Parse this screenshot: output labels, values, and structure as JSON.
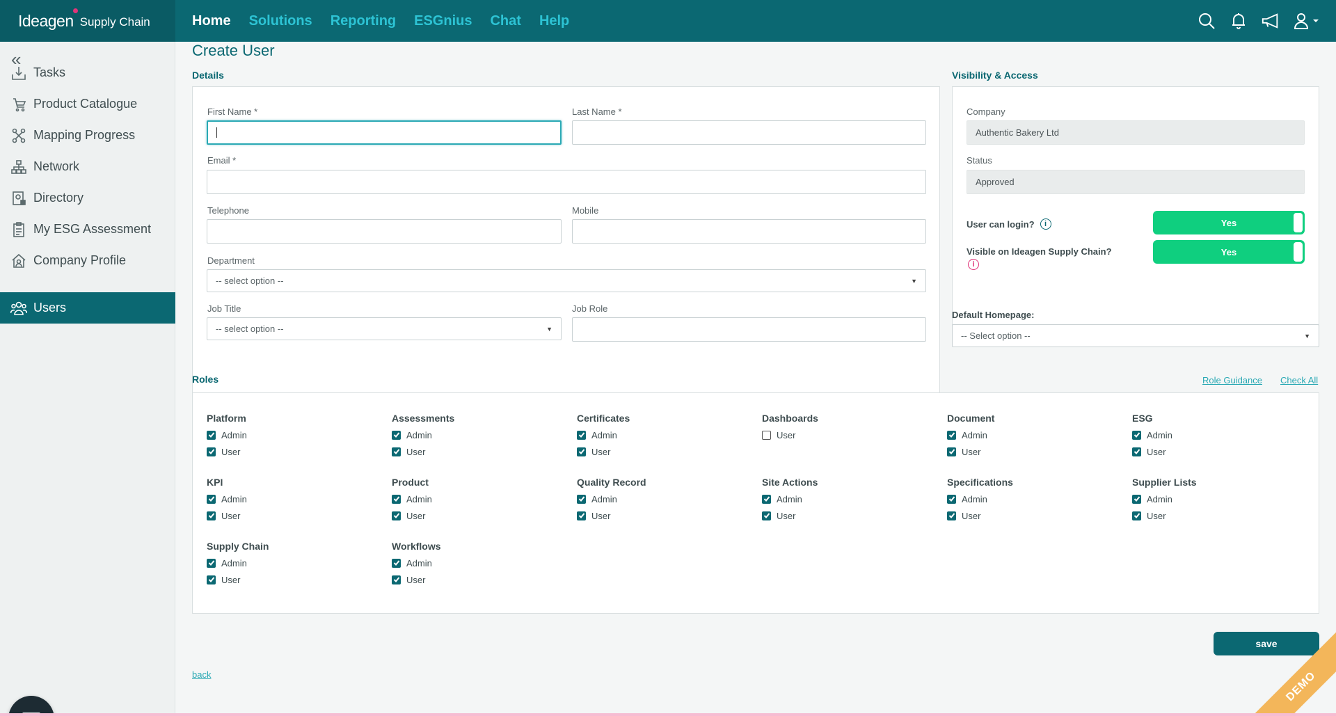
{
  "brand": {
    "name": "Ideagen",
    "product": "Supply Chain"
  },
  "topnav": [
    {
      "label": "Home"
    },
    {
      "label": "Solutions"
    },
    {
      "label": "Reporting"
    },
    {
      "label": "ESGnius"
    },
    {
      "label": "Chat"
    },
    {
      "label": "Help"
    }
  ],
  "topicons": [
    "search-icon",
    "bell-icon",
    "megaphone-icon",
    "user-icon"
  ],
  "sidebar": {
    "collapse_icon": "«",
    "items": [
      {
        "label": "Tasks",
        "icon": "tray-icon"
      },
      {
        "label": "Product Catalogue",
        "icon": "product-icon"
      },
      {
        "label": "Mapping Progress",
        "icon": "mapping-icon"
      },
      {
        "label": "Network",
        "icon": "network-icon"
      },
      {
        "label": "Directory",
        "icon": "directory-icon"
      },
      {
        "label": "My ESG Assessment",
        "icon": "clipboard-icon"
      },
      {
        "label": "Company Profile",
        "icon": "company-icon"
      },
      {
        "label": "Users",
        "icon": "users-icon",
        "active": true
      }
    ]
  },
  "page": {
    "title": "Create User"
  },
  "details": {
    "section_title": "Details",
    "first_name_label": "First Name *",
    "first_name_value": "",
    "last_name_label": "Last Name *",
    "last_name_value": "",
    "email_label": "Email *",
    "email_value": "",
    "telephone_label": "Telephone",
    "telephone_value": "",
    "mobile_label": "Mobile",
    "mobile_value": "",
    "department_label": "Department",
    "department_value": "-- select option --",
    "job_title_label": "Job Title",
    "job_title_value": "-- select option --",
    "job_role_label": "Job Role",
    "job_role_value": ""
  },
  "visibility": {
    "section_title": "Visibility & Access",
    "company_label": "Company",
    "company_value": "Authentic Bakery Ltd",
    "status_label": "Status",
    "status_value": "Approved",
    "user_can_login_label": "User can login?",
    "user_can_login_value": "Yes",
    "visible_label": "Visible on Ideagen Supply Chain?",
    "visible_value": "Yes",
    "info_icon_color_login": "#0b6872",
    "info_icon_color_visible": "#e0357a"
  },
  "default_homepage": {
    "label": "Default Homepage:",
    "value": "-- Select option --"
  },
  "roles": {
    "section_title": "Roles",
    "role_guidance": "Role Guidance",
    "check_all": "Check All",
    "groups": [
      {
        "title": "Platform",
        "options": [
          {
            "label": "Admin",
            "checked": true
          },
          {
            "label": "User",
            "checked": true
          }
        ]
      },
      {
        "title": "Assessments",
        "options": [
          {
            "label": "Admin",
            "checked": true
          },
          {
            "label": "User",
            "checked": true
          }
        ]
      },
      {
        "title": "Certificates",
        "options": [
          {
            "label": "Admin",
            "checked": true
          },
          {
            "label": "User",
            "checked": true
          }
        ]
      },
      {
        "title": "Dashboards",
        "options": [
          {
            "label": "User",
            "checked": false
          }
        ]
      },
      {
        "title": "Document",
        "options": [
          {
            "label": "Admin",
            "checked": true
          },
          {
            "label": "User",
            "checked": true
          }
        ]
      },
      {
        "title": "ESG",
        "options": [
          {
            "label": "Admin",
            "checked": true
          },
          {
            "label": "User",
            "checked": true
          }
        ]
      },
      {
        "title": "KPI",
        "options": [
          {
            "label": "Admin",
            "checked": true
          },
          {
            "label": "User",
            "checked": true
          }
        ]
      },
      {
        "title": "Product",
        "options": [
          {
            "label": "Admin",
            "checked": true
          },
          {
            "label": "User",
            "checked": true
          }
        ]
      },
      {
        "title": "Quality Record",
        "options": [
          {
            "label": "Admin",
            "checked": true
          },
          {
            "label": "User",
            "checked": true
          }
        ]
      },
      {
        "title": "Site Actions",
        "options": [
          {
            "label": "Admin",
            "checked": true
          },
          {
            "label": "User",
            "checked": true
          }
        ]
      },
      {
        "title": "Specifications",
        "options": [
          {
            "label": "Admin",
            "checked": true
          },
          {
            "label": "User",
            "checked": true
          }
        ]
      },
      {
        "title": "Supplier Lists",
        "options": [
          {
            "label": "Admin",
            "checked": true
          },
          {
            "label": "User",
            "checked": true
          }
        ]
      },
      {
        "title": "Supply Chain",
        "options": [
          {
            "label": "Admin",
            "checked": true
          },
          {
            "label": "User",
            "checked": true
          }
        ]
      },
      {
        "title": "Workflows",
        "options": [
          {
            "label": "Admin",
            "checked": true
          },
          {
            "label": "User",
            "checked": true
          }
        ]
      }
    ]
  },
  "actions": {
    "save_label": "save",
    "back_label": "back"
  },
  "demo_label": "DEMO",
  "colors": {
    "primary": "#0b6872",
    "accent": "#2dc3d4",
    "toggle_on": "#0fcf7f",
    "demo": "#f3b65a"
  }
}
